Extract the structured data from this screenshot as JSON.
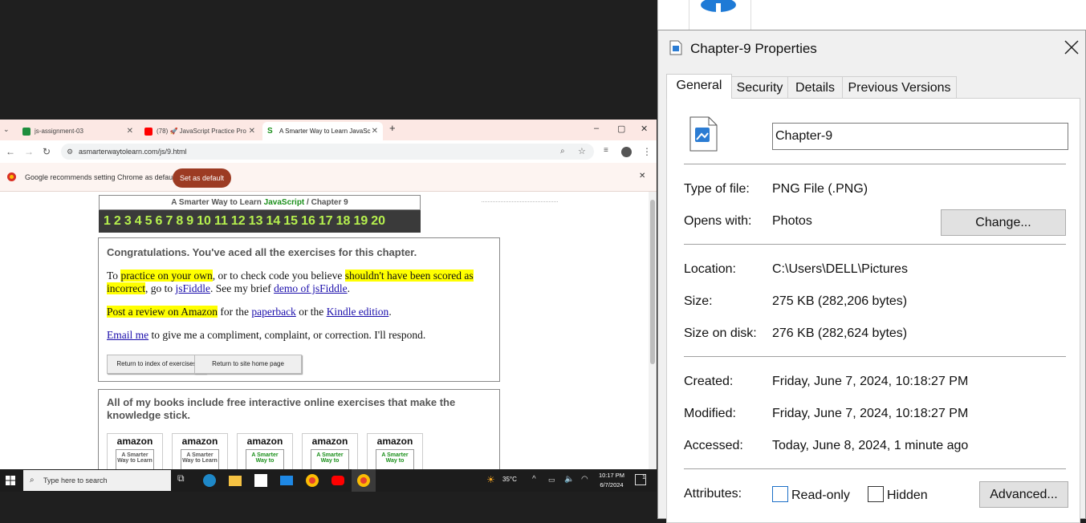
{
  "browser": {
    "tabs": [
      {
        "title": "js-assignment-03",
        "icon": "google-sheets-icon",
        "color": "#1e8e3e"
      },
      {
        "title": "(78) 🚀 JavaScript Practice Pro",
        "icon": "youtube-icon",
        "color": "#ff0000"
      },
      {
        "title": "A Smarter Way to Learn JavaSc",
        "icon": "site-favicon",
        "color": "#1a8f1a"
      }
    ],
    "new_tab": "+",
    "window_controls": {
      "minimize": "–",
      "maximize": "▢",
      "close": "✕"
    },
    "url": "asmarterwaytolearn.com/js/9.html",
    "infobar": {
      "message": "Google recommends setting Chrome as default",
      "button": "Set as default",
      "close": "✕"
    }
  },
  "page": {
    "header": {
      "prefix": "A Smarter Way to Learn ",
      "brand": "JavaScript",
      "suffix": "  /  Chapter 9"
    },
    "chapter_numbers": [
      "1",
      "2",
      "3",
      "4",
      "5",
      "6",
      "7",
      "8",
      "9",
      "10",
      "11",
      "12",
      "13",
      "14",
      "15",
      "16",
      "17",
      "18",
      "19",
      "20"
    ],
    "congrats": {
      "heading": "Congratulations. You've aced all the exercises for this chapter.",
      "p1_a": "To ",
      "p1_hl1": "practice on your own",
      "p1_b": ", or to check code you believe ",
      "p1_hl2": "shouldn't have been scored as incorrect",
      "p1_c": ", go to ",
      "p1_link1": "jsFiddle",
      "p1_d": ". See my brief ",
      "p1_link2": "demo of jsFiddle",
      "p1_e": ".",
      "p2_hl": "Post a review on Amazon",
      "p2_a": " for the ",
      "p2_link1": "paperback",
      "p2_b": " or the ",
      "p2_link2": "Kindle edition",
      "p2_c": ".",
      "p3_link": "Email me",
      "p3_a": " to give me a compliment, complaint, or correction. I'll respond.",
      "btn_index": "Return to index of exercises",
      "btn_home": "Return to site home page"
    },
    "books": {
      "text": "All of my books include free interactive online exercises that make the knowledge stick.",
      "items": [
        {
          "brand": "amazon",
          "cover": "A Smarter Way to Learn"
        },
        {
          "brand": "amazon",
          "cover": "A Smarter Way to Learn"
        },
        {
          "brand": "amazon",
          "cover": "A Smarter Way to"
        },
        {
          "brand": "amazon",
          "cover": "A Smarter Way to"
        },
        {
          "brand": "amazon",
          "cover": "A Smarter Way to"
        }
      ]
    }
  },
  "taskbar": {
    "search_placeholder": "Type here to search",
    "temperature": "35°C",
    "time": "10:17 PM",
    "date": "6/7/2024",
    "notification_count": "1"
  },
  "dialog": {
    "title": "Chapter-9 Properties",
    "tabs": [
      "General",
      "Security",
      "Details",
      "Previous Versions"
    ],
    "file_name": "Chapter-9",
    "type_label": "Type of file:",
    "type_value": "PNG File (.PNG)",
    "opens_label": "Opens with:",
    "opens_value": "Photos",
    "change_button": "Change...",
    "location_label": "Location:",
    "location_value": "C:\\Users\\DELL\\Pictures",
    "size_label": "Size:",
    "size_value": "275 KB (282,206 bytes)",
    "size_disk_label": "Size on disk:",
    "size_disk_value": "276 KB (282,624 bytes)",
    "created_label": "Created:",
    "created_value": "Friday, June 7, 2024, 10:18:27 PM",
    "modified_label": "Modified:",
    "modified_value": "Friday, June 7, 2024, 10:18:27 PM",
    "accessed_label": "Accessed:",
    "accessed_value": "Today, June 8, 2024, 1 minute ago",
    "attributes_label": "Attributes:",
    "readonly_label": "Read-only",
    "hidden_label": "Hidden",
    "advanced_button": "Advanced..."
  }
}
